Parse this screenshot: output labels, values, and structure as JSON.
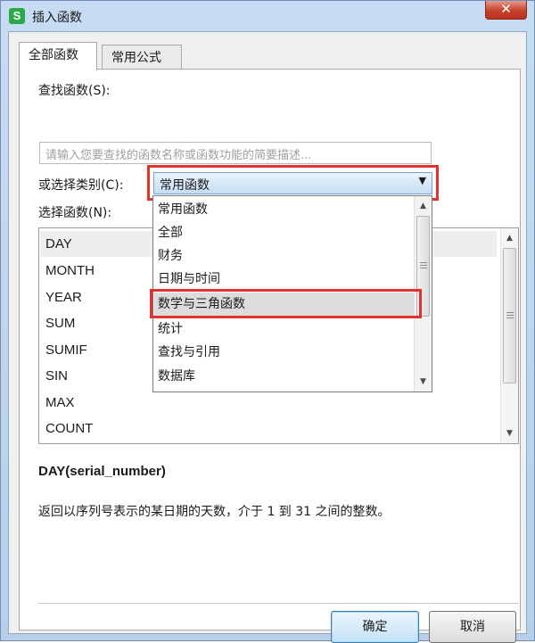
{
  "window": {
    "title": "插入函数",
    "app_icon_letter": "S",
    "close_label": "✕"
  },
  "tabs": [
    {
      "label": "全部函数",
      "active": true
    },
    {
      "label": "常用公式",
      "active": false
    }
  ],
  "search": {
    "label": "查找函数(S):",
    "placeholder": "请输入您要查找的函数名称或函数功能的简要描述..."
  },
  "category": {
    "label": "或选择类别(C):",
    "selected": "常用函数",
    "options": [
      "常用函数",
      "全部",
      "财务",
      "日期与时间",
      "数学与三角函数",
      "统计",
      "查找与引用",
      "数据库"
    ],
    "highlighted_option": "数学与三角函数"
  },
  "function_list": {
    "label": "选择函数(N):",
    "items": [
      "DAY",
      "MONTH",
      "YEAR",
      "SUM",
      "SUMIF",
      "SIN",
      "MAX",
      "COUNT"
    ],
    "selected": "DAY"
  },
  "details": {
    "signature": "DAY(serial_number)",
    "description": "返回以序列号表示的某日期的天数，介于 1 到 31 之间的整数。"
  },
  "buttons": {
    "ok": "确定",
    "cancel": "取消"
  },
  "colors": {
    "highlight_frame": "#e1322e",
    "app_icon": "#2aa84a",
    "close_button": "#c8412b"
  },
  "icons": {
    "combo_arrow": "▼",
    "scroll_up": "▲",
    "scroll_down": "▼"
  }
}
